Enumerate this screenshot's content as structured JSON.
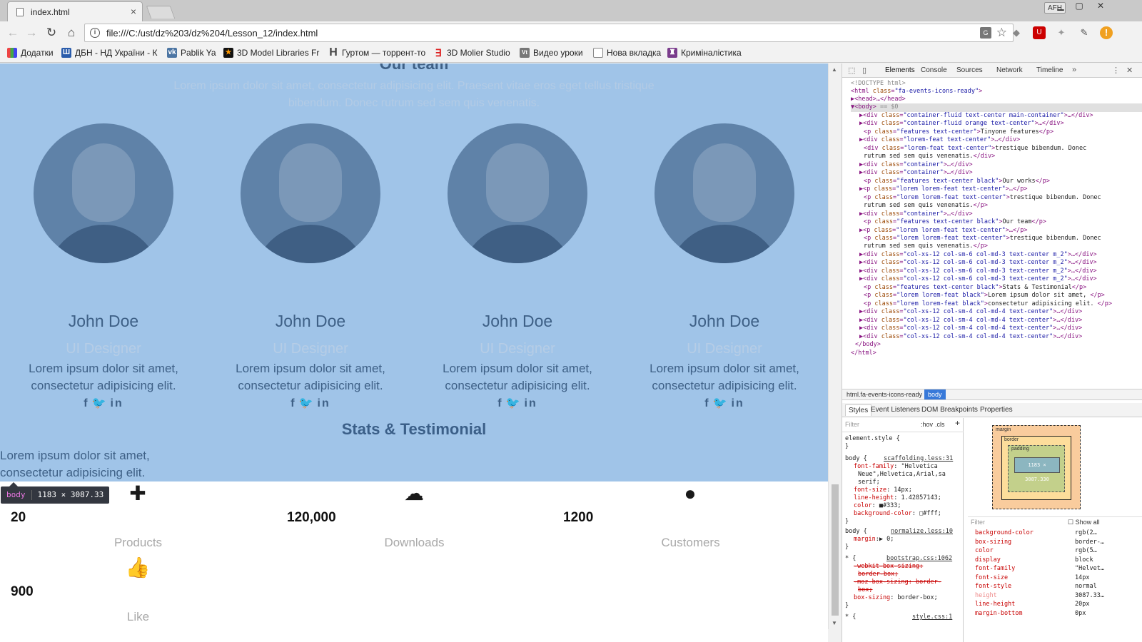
{
  "browser": {
    "tab_title": "index.html",
    "tab_close": "×",
    "profile": "AFH",
    "url": "file:///C:/ust/dz%203/dz%204/Lesson_12/index.html",
    "bookmarks": [
      "Додатки",
      "ДБН - НД України - К",
      "Pablik Ya",
      "3D Model Libraries Fr",
      "Гуртом — торрент-то",
      "3D Molier Studio",
      "Видео уроки",
      "Нова вкладка",
      "Криміналістика"
    ]
  },
  "page": {
    "team_title": "Our team",
    "team_intro": "Lorem ipsum dolor sit amet, consectetur adipisicing elit. Praesent vitae eros eget tellus tristique bibendum. Donec rutrum sed sem quis venenatis.",
    "members": [
      {
        "name": "John Doe",
        "role": "UI Designer",
        "desc": "Lorem ipsum dolor sit amet, consectetur adipisicing elit."
      },
      {
        "name": "John Doe",
        "role": "UI Designer",
        "desc": "Lorem ipsum dolor sit amet, consectetur adipisicing elit."
      },
      {
        "name": "John Doe",
        "role": "UI Designer",
        "desc": "Lorem ipsum dolor sit amet, consectetur adipisicing elit."
      },
      {
        "name": "John Doe",
        "role": "UI Designer",
        "desc": "Lorem ipsum dolor sit amet, consectetur adipisicing elit."
      }
    ],
    "social": [
      "f",
      "t",
      "in"
    ],
    "stats_title": "Stats & Testimonial",
    "stats_intro": "Lorem ipsum dolor sit amet, consectetur adipisicing elit.",
    "stats": [
      {
        "icon": "puzzle-icon",
        "glyph": "✚",
        "number": "20",
        "label": "Products"
      },
      {
        "icon": "cloud-download-icon",
        "glyph": "☁",
        "number": "120,000",
        "label": "Downloads"
      },
      {
        "icon": "users-icon",
        "glyph": "●",
        "number": "1200",
        "label": "Customers"
      },
      {
        "icon": "thumbs-up-icon",
        "glyph": "👍",
        "number": "900",
        "label": "Like"
      }
    ]
  },
  "inspector": {
    "tooltip_tag": "body",
    "tooltip_size": "1183 × 3087.33"
  },
  "devtools": {
    "tabs": [
      "Elements",
      "Console",
      "Sources",
      "Network",
      "Timeline"
    ],
    "breadcrumb": [
      "html.fa-events-icons-ready",
      "body"
    ],
    "subtabs": [
      "Styles",
      "Event Listeners",
      "DOM Breakpoints",
      "Properties"
    ],
    "filter_placeholder": "Filter",
    "hov": ":hov",
    "cls": ".cls",
    "boxmodel_margin": "margin",
    "boxmodel_border": "border",
    "boxmodel_padding": "padding",
    "boxmodel_content": "1183 × 3087.330",
    "show_all": "Show all",
    "computed": [
      {
        "k": "background-color",
        "v": "rgb(2…"
      },
      {
        "k": "box-sizing",
        "v": "border-…"
      },
      {
        "k": "color",
        "v": "rgb(5…"
      },
      {
        "k": "display",
        "v": "block"
      },
      {
        "k": "font-family",
        "v": "\"Helvet…"
      },
      {
        "k": "font-size",
        "v": "14px"
      },
      {
        "k": "font-style",
        "v": "normal"
      },
      {
        "k": "height",
        "v": "3087.33…"
      },
      {
        "k": "line-height",
        "v": "20px"
      },
      {
        "k": "margin-bottom",
        "v": "0px"
      }
    ]
  }
}
